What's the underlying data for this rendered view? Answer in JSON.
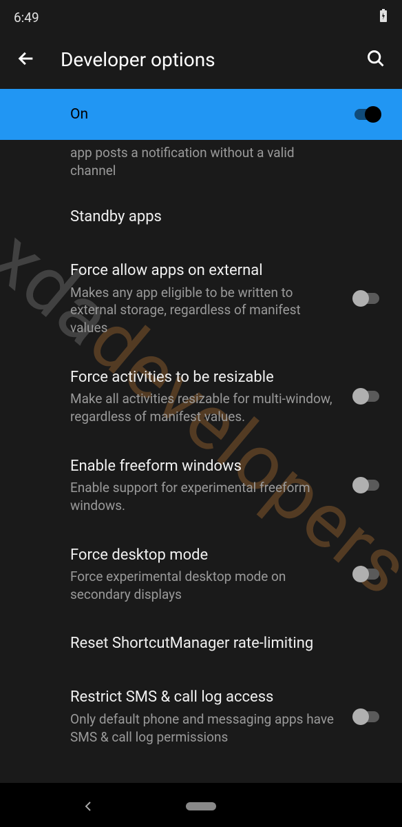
{
  "status_bar": {
    "time": "6:49"
  },
  "header": {
    "title": "Developer options"
  },
  "master_toggle": {
    "label": "On",
    "enabled": true
  },
  "partial_item": {
    "desc": "app posts a notification without a valid channel"
  },
  "settings": [
    {
      "title": "Standby apps",
      "desc": "",
      "has_toggle": false
    },
    {
      "title": "Force allow apps on external",
      "desc": "Makes any app eligible to be written to external storage, regardless of manifest values",
      "has_toggle": true,
      "toggle_on": false
    },
    {
      "title": "Force activities to be resizable",
      "desc": "Make all activities resizable for multi-window, regardless of manifest values.",
      "has_toggle": true,
      "toggle_on": false
    },
    {
      "title": "Enable freeform windows",
      "desc": "Enable support for experimental freeform windows.",
      "has_toggle": true,
      "toggle_on": false
    },
    {
      "title": "Force desktop mode",
      "desc": "Force experimental desktop mode on secondary displays",
      "has_toggle": true,
      "toggle_on": false
    },
    {
      "title": "Reset ShortcutManager rate-limiting",
      "desc": "",
      "has_toggle": false
    },
    {
      "title": "Restrict SMS & call log access",
      "desc": "Only default phone and messaging apps have SMS & call log permissions",
      "has_toggle": true,
      "toggle_on": false
    }
  ],
  "watermark": {
    "part1": "xda",
    "part2": "developers"
  }
}
